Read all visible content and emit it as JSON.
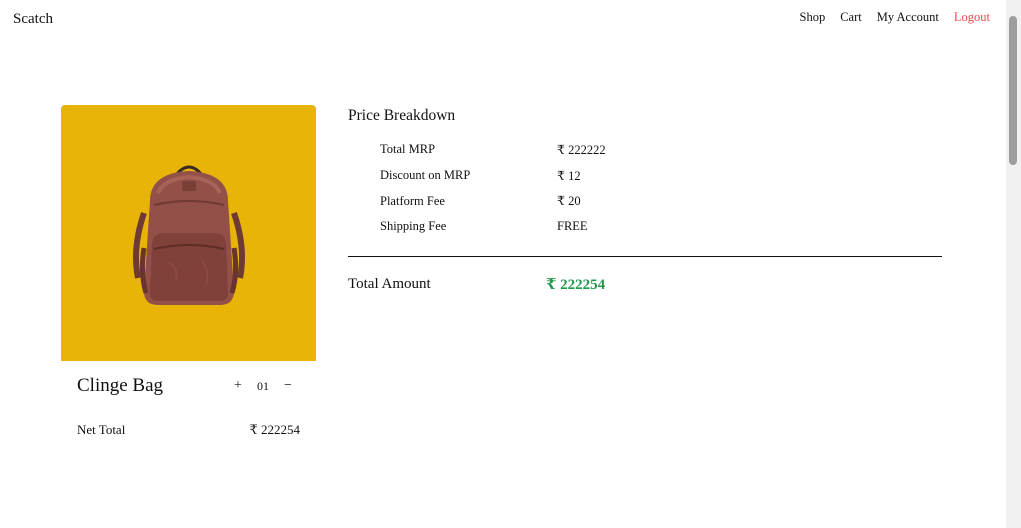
{
  "nav": {
    "brand": "Scatch",
    "links": {
      "shop": "Shop",
      "cart": "Cart",
      "account": "My Account",
      "logout": "Logout"
    }
  },
  "product": {
    "name": "Clinge Bag",
    "quantity": "01",
    "increment": "+",
    "decrement": "−",
    "net_total_label": "Net Total",
    "net_total_value": "₹ 222254",
    "bg_color": "#e8b408"
  },
  "breakdown": {
    "title": "Price Breakdown",
    "rows": [
      {
        "label": "Total MRP",
        "value": "₹ 222222"
      },
      {
        "label": "Discount on MRP",
        "value": "₹ 12"
      },
      {
        "label": "Platform Fee",
        "value": "₹ 20"
      },
      {
        "label": "Shipping Fee",
        "value": "FREE"
      }
    ],
    "total_label": "Total Amount",
    "total_value": "₹ 222254",
    "total_color": "#1f9a4a"
  }
}
